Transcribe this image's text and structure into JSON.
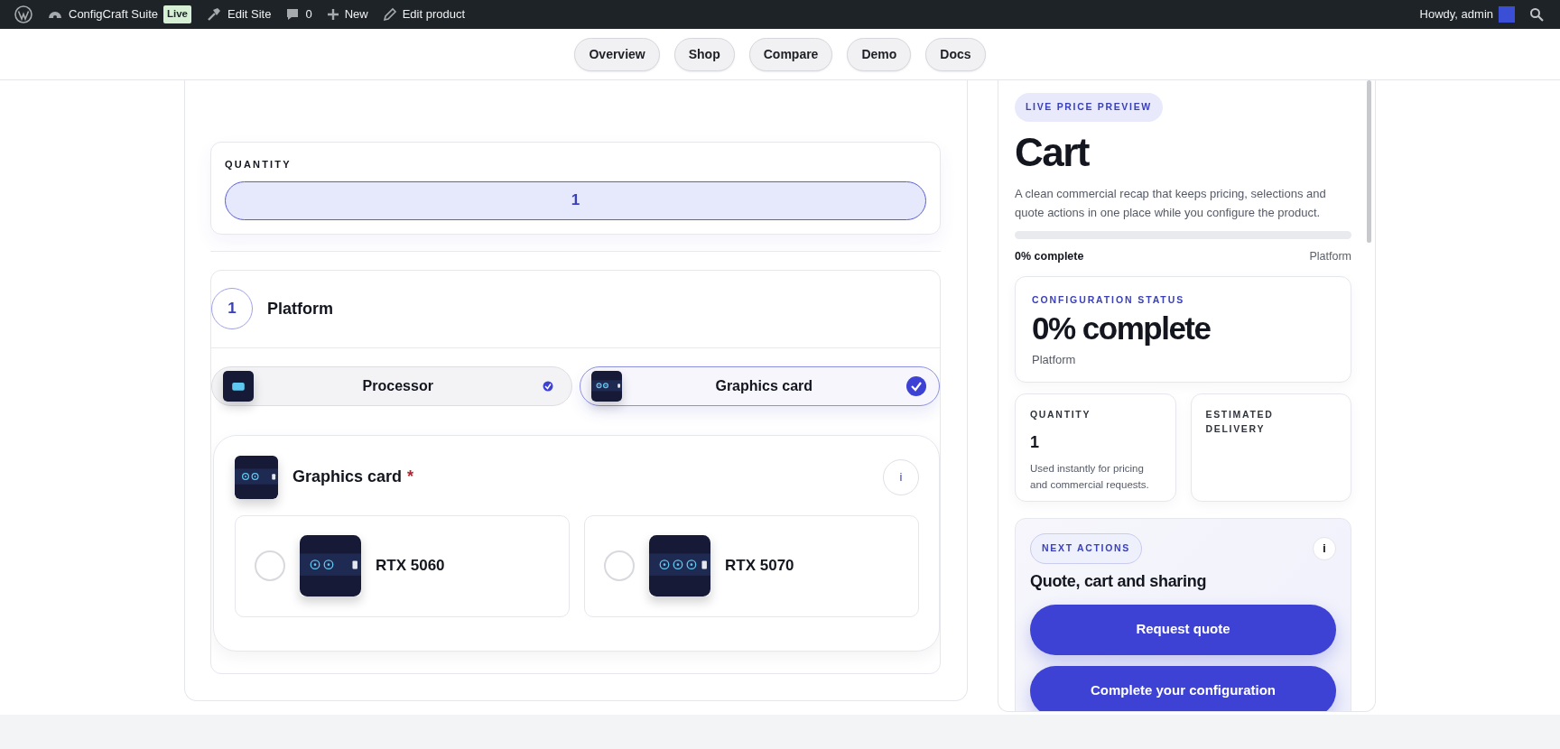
{
  "admin_bar": {
    "items": [
      {
        "kind": "logo"
      },
      {
        "kind": "site",
        "label": "ConfigCraft Suite",
        "badge": "Live"
      },
      {
        "kind": "edit",
        "label": "Edit Site"
      },
      {
        "kind": "comments",
        "label": "0"
      },
      {
        "kind": "new",
        "label": "New"
      },
      {
        "kind": "pencil",
        "label": "Edit product"
      }
    ],
    "greeting": "Howdy, admin"
  },
  "nav": [
    "Overview",
    "Shop",
    "Compare",
    "Demo",
    "Docs"
  ],
  "quantity": {
    "label": "QUANTITY",
    "value": "1"
  },
  "step": {
    "number": "1",
    "title": "Platform",
    "tabs": [
      {
        "label": "Processor",
        "kind": "cpu",
        "selected": false
      },
      {
        "label": "Graphics card",
        "kind": "gpu",
        "selected": true
      }
    ]
  },
  "group": {
    "title": "Graphics card",
    "required_mark": "*",
    "info": "i",
    "options": [
      {
        "label": "RTX 5060",
        "kind": "two-fan",
        "selected": false
      },
      {
        "label": "RTX 5070",
        "kind": "three-fan",
        "selected": false
      }
    ]
  },
  "summary": {
    "badge": "LIVE PRICE PREVIEW",
    "title": "Cart",
    "description": "A clean commercial recap that keeps pricing, selections and quote actions in one place while you configure the product.",
    "level": 0,
    "progress_label": "0% complete",
    "progress_step": "Platform",
    "status": {
      "label": "CONFIGURATION STATUS",
      "value": "0% complete",
      "step": "Platform"
    },
    "stats": [
      {
        "label": "QUANTITY",
        "value": "1",
        "note": "Used instantly for pricing and commercial requests."
      },
      {
        "label": "ESTIMATED DELIVERY"
      }
    ],
    "actions": {
      "badge": "NEXT ACTIONS",
      "info": "i",
      "title": "Quote, cart and sharing",
      "buttons": [
        "Request quote",
        "Complete your configuration"
      ]
    }
  }
}
